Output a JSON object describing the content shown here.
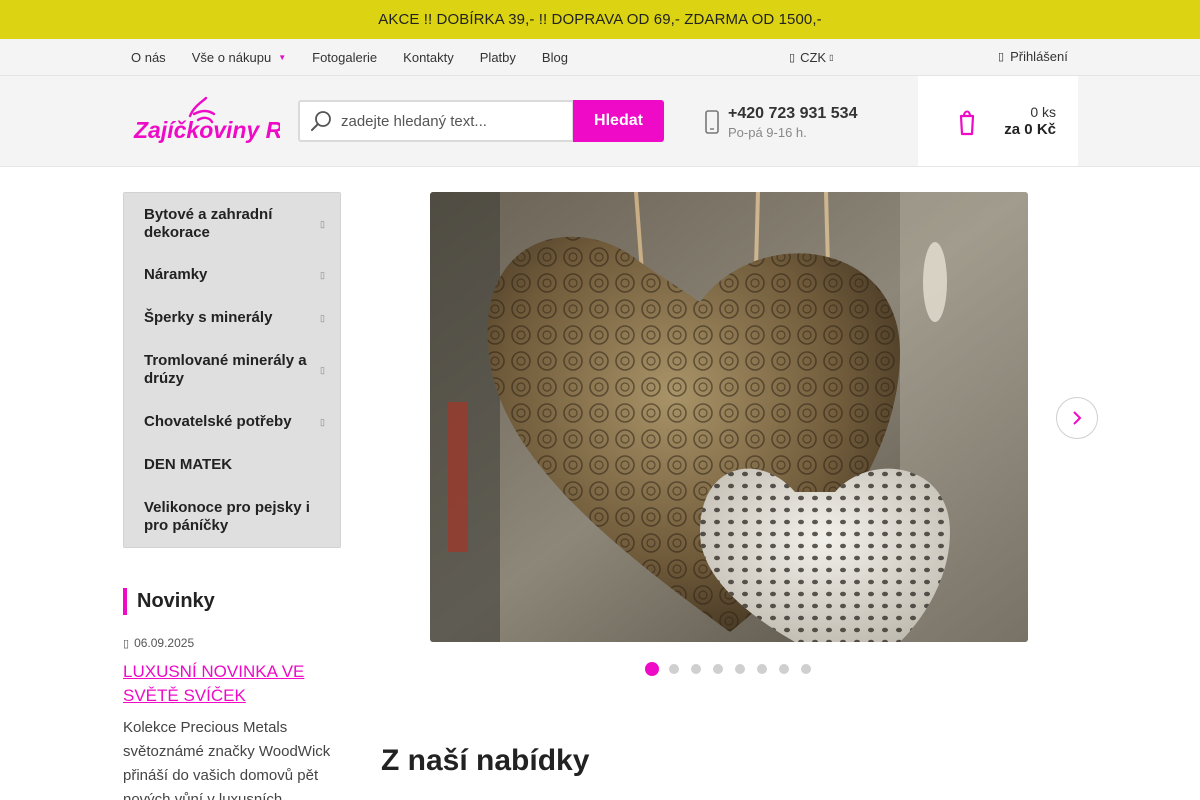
{
  "promo": {
    "text": "AKCE !! DOBÍRKA 39,- !! DOPRAVA OD 69,- ZDARMA OD 1500,-"
  },
  "topnav": {
    "items": [
      {
        "label": "O nás"
      },
      {
        "label": "Vše o nákupu"
      },
      {
        "label": "Fotogalerie"
      },
      {
        "label": "Kontakty"
      },
      {
        "label": "Platby"
      },
      {
        "label": "Blog"
      }
    ],
    "currency": "CZK",
    "login": "Přihlášení"
  },
  "header": {
    "logo_text": "Zajíčkoviny RZ",
    "search": {
      "placeholder": "zadejte hledaný text...",
      "button": "Hledat"
    },
    "phone": {
      "number": "+420 723 931 534",
      "hours": "Po-pá 9-16 h."
    },
    "cart": {
      "count": "0 ks",
      "total": "za 0 Kč"
    }
  },
  "categories": [
    {
      "label": "Bytové a zahradní dekorace",
      "has_submenu": true
    },
    {
      "label": "Náramky",
      "has_submenu": true
    },
    {
      "label": "Šperky s minerály",
      "has_submenu": true
    },
    {
      "label": "Tromlované minerály a drúzy",
      "has_submenu": true
    },
    {
      "label": "Chovatelské potřeby",
      "has_submenu": true
    },
    {
      "label": "DEN MATEK",
      "has_submenu": false
    },
    {
      "label": "Velikonoce pro pejsky i pro páníčky",
      "has_submenu": false
    }
  ],
  "news": {
    "title": "Novinky",
    "date": "06.09.2025",
    "headline": "LUXUSNÍ NOVINKA VE SVĚTĚ SVÍČEK",
    "text": "Kolekce Precious Metals světoznámé značky WoodWick přináší do vašich domovů pět nových vůní v luxusních"
  },
  "carousel": {
    "slide_count": 8,
    "active_slide": 1
  },
  "section": {
    "title": "Z naší nabídky"
  },
  "colors": {
    "accent": "#ee0ac6",
    "promo_bar": "#dcd412",
    "header_bg": "#f4f4f4"
  }
}
